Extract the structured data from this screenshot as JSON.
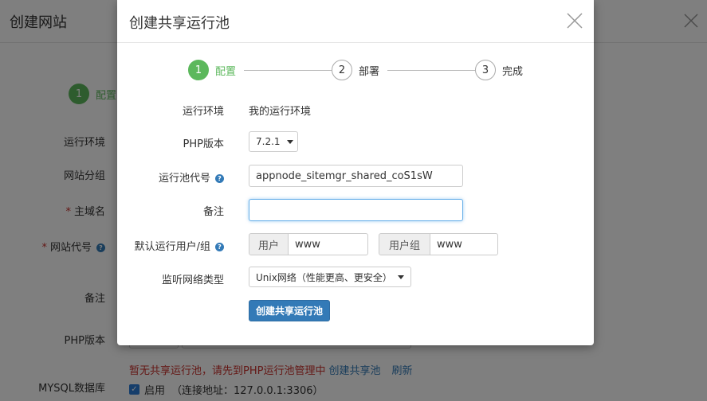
{
  "background": {
    "title": "创建网站",
    "step1": {
      "number": "1",
      "label": "配置"
    },
    "labels": {
      "runtime_env": "运行环境",
      "site_group": "网站分组",
      "main_domain": "主域名",
      "site_code": "网站代号",
      "remark": "备注",
      "php_version": "PHP版本",
      "mysql": "MYSQL数据库"
    },
    "warning": {
      "text": "暂无共享运行池，请先到PHP运行池管理中",
      "create_link": "创建共享池",
      "refresh_link": "刷新"
    },
    "mysql_enable": {
      "label": "启用",
      "detail": "（连接地址：127.0.0.1:3306）"
    }
  },
  "modal": {
    "title": "创建共享运行池",
    "steps": [
      {
        "number": "1",
        "label": "配置"
      },
      {
        "number": "2",
        "label": "部署"
      },
      {
        "number": "3",
        "label": "完成"
      }
    ],
    "fields": {
      "runtime_env": {
        "label": "运行环境",
        "value": "我的运行环境"
      },
      "php_version": {
        "label": "PHP版本",
        "value": "7.2.1"
      },
      "pool_code": {
        "label": "运行池代号",
        "value": "appnode_sitemgr_shared_coS1sW"
      },
      "remark": {
        "label": "备注",
        "value": ""
      },
      "default_user": {
        "label": "默认运行用户/组",
        "user_addon": "用户",
        "user_value": "www",
        "group_addon": "用户组",
        "group_value": "www"
      },
      "listen_type": {
        "label": "监听网络类型",
        "value": "Unix网络（性能更高、更安全）"
      }
    },
    "submit_label": "创建共享运行池"
  },
  "colors": {
    "accent_green": "#5cb85c",
    "primary_blue": "#337ab7",
    "error_red": "#c9302c"
  }
}
